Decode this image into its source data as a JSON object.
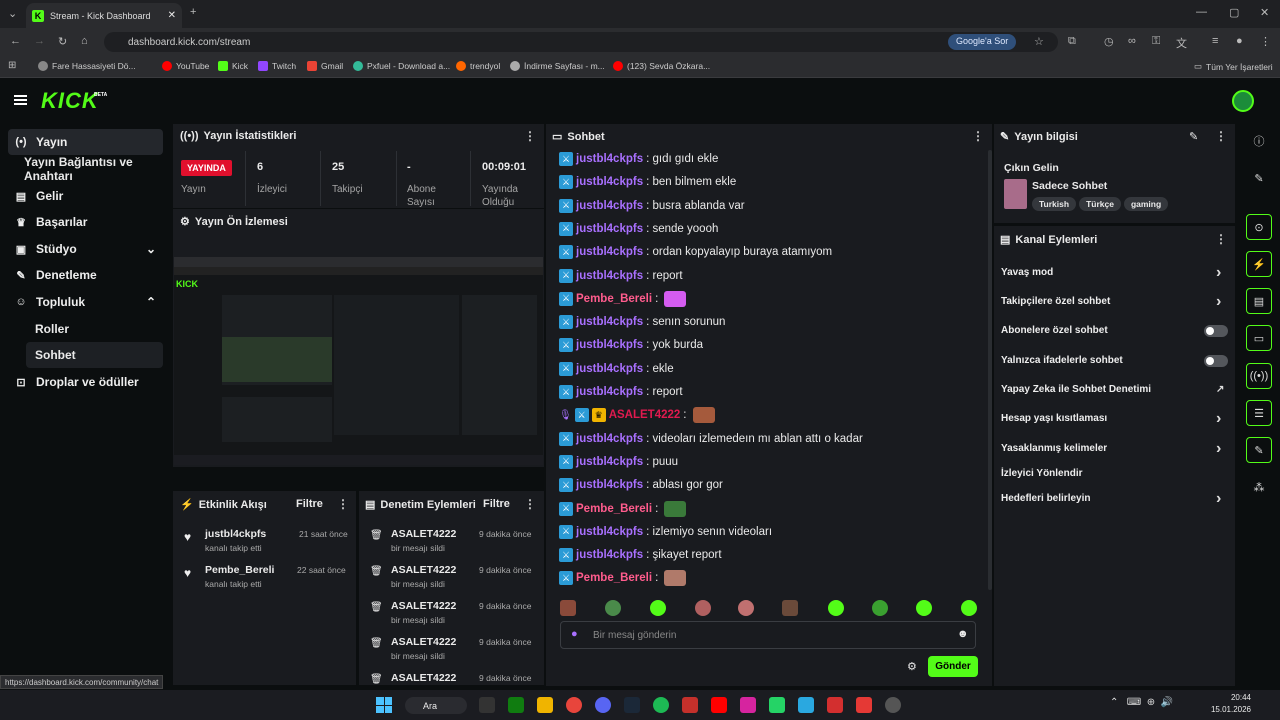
{
  "browser": {
    "tab_title": "Stream - Kick Dashboard",
    "url": "dashboard.kick.com/stream",
    "google_label": "Google'a Sor",
    "bookmarks": [
      "Fare Hassasiyeti Dö...",
      "YouTube",
      "Kick",
      "Twitch",
      "Gmail",
      "Pxfuel - Download a...",
      "trendyol",
      "İndirme Sayfası - m...",
      "(123) Sevda Özkara..."
    ],
    "all_bookmarks": "Tüm Yer İşaretleri"
  },
  "app": {
    "logo": "KICK",
    "beta": "BETA"
  },
  "sidebar": {
    "items": [
      {
        "label": "Yayın",
        "icon": "broadcast-icon"
      },
      {
        "label": "Yayın Bağlantısı ve Anahtarı"
      },
      {
        "label": "Gelir",
        "icon": "chart-icon"
      },
      {
        "label": "Başarılar",
        "icon": "trophy-icon"
      },
      {
        "label": "Stüdyo",
        "icon": "studio-icon"
      },
      {
        "label": "Denetleme",
        "icon": "wrench-icon"
      },
      {
        "label": "Topluluk",
        "icon": "people-icon"
      },
      {
        "label": "Roller"
      },
      {
        "label": "Sohbet"
      },
      {
        "label": "Droplar ve ödüller",
        "icon": "gift-icon"
      }
    ]
  },
  "stats": {
    "title": "Yayın İstatistikleri",
    "live_badge": "YAYINDA",
    "live_label": "Yayın",
    "viewers": "6",
    "viewers_label": "İzleyici",
    "followers": "25",
    "followers_label": "Takipçi",
    "subs": "-",
    "subs_label": "Abone Sayısı",
    "uptime": "00:09:01",
    "uptime_label": "Yayında Olduğu"
  },
  "preview": {
    "title": "Yayın Ön İzlemesi"
  },
  "activity": {
    "title": "Etkinlik Akışı",
    "filter": "Filtre",
    "items": [
      {
        "user": "justbl4ckpfs",
        "sub": "kanalı takip etti",
        "time": "21 saat önce"
      },
      {
        "user": "Pembe_Bereli",
        "sub": "kanalı takip etti",
        "time": "22 saat önce"
      }
    ]
  },
  "moderation": {
    "title": "Denetim Eylemleri",
    "filter": "Filtre",
    "items": [
      {
        "user": "ASALET4222",
        "sub": "bir mesajı sildi",
        "time": "9 dakika önce"
      },
      {
        "user": "ASALET4222",
        "sub": "bir mesajı sildi",
        "time": "9 dakika önce"
      },
      {
        "user": "ASALET4222",
        "sub": "bir mesajı sildi",
        "time": "9 dakika önce"
      },
      {
        "user": "ASALET4222",
        "sub": "bir mesajı sildi",
        "time": "9 dakika önce"
      },
      {
        "user": "ASALET4222",
        "sub": "",
        "time": "9 dakika önce"
      }
    ]
  },
  "chat": {
    "title": "Sohbet",
    "messages": [
      {
        "user": "justbl4ckpfs",
        "text": ": gıdı gıdı ekle"
      },
      {
        "user": "justbl4ckpfs",
        "text": ": ben bilmem ekle"
      },
      {
        "user": "justbl4ckpfs",
        "text": ": busra ablanda var"
      },
      {
        "user": "justbl4ckpfs",
        "text": ": sende yoooh"
      },
      {
        "user": "justbl4ckpfs",
        "text": ": ordan kopyalayıp buraya atamıyom"
      },
      {
        "user": "justbl4ckpfs",
        "text": ": report"
      },
      {
        "user": "Pembe_Bereli",
        "text": ":"
      },
      {
        "user": "justbl4ckpfs",
        "text": ": senın sorunun"
      },
      {
        "user": "justbl4ckpfs",
        "text": ": yok burda"
      },
      {
        "user": "justbl4ckpfs",
        "text": ": ekle"
      },
      {
        "user": "justbl4ckpfs",
        "text": ": report"
      },
      {
        "user": "ASALET4222",
        "text": ":"
      },
      {
        "user": "justbl4ckpfs",
        "text": ": videoları izlemedeın mı ablan attı o kadar"
      },
      {
        "user": "justbl4ckpfs",
        "text": ": puuu"
      },
      {
        "user": "justbl4ckpfs",
        "text": ": ablası gor gor"
      },
      {
        "user": "Pembe_Bereli",
        "text": ":"
      },
      {
        "user": "justbl4ckpfs",
        "text": ": izlemiyo senın videoları"
      },
      {
        "user": "justbl4ckpfs",
        "text": ": şikayet report"
      },
      {
        "user": "Pembe_Bereli",
        "text": ":"
      }
    ],
    "placeholder": "Bir mesaj gönderin",
    "send": "Gönder"
  },
  "info": {
    "title": "Yayın bilgisi",
    "stream_title": "Çıkın Gelin",
    "category": "Sadece Sohbet",
    "tags": [
      "Turkish",
      "Türkçe",
      "gaming"
    ]
  },
  "channel_actions": {
    "title": "Kanal Eylemleri",
    "items": [
      {
        "label": "Yavaş mod",
        "control": "chevron"
      },
      {
        "label": "Takipçilere özel sohbet",
        "control": "chevron"
      },
      {
        "label": "Abonelere özel sohbet",
        "control": "toggle"
      },
      {
        "label": "Yalnızca ifadelerle sohbet",
        "control": "toggle"
      },
      {
        "label": "Yapay Zeka ile Sohbet Denetimi",
        "control": "external"
      },
      {
        "label": "Hesap yaşı kısıtlaması",
        "control": "chevron"
      },
      {
        "label": "Yasaklanmış kelimeler",
        "control": "chevron"
      },
      {
        "label": "İzleyici Yönlendir",
        "control": "none"
      },
      {
        "label": "Hedefleri belirleyin",
        "control": "chevron"
      }
    ]
  },
  "statusbar": "https://dashboard.kick.com/community/chat",
  "taskbar": {
    "search": "Ara",
    "time": "20:44",
    "date": "15.01.2026"
  },
  "colors": {
    "accent": "#53fc18",
    "live": "#e1102d",
    "username": "#a970ff",
    "username2": "#ff5c8d"
  }
}
